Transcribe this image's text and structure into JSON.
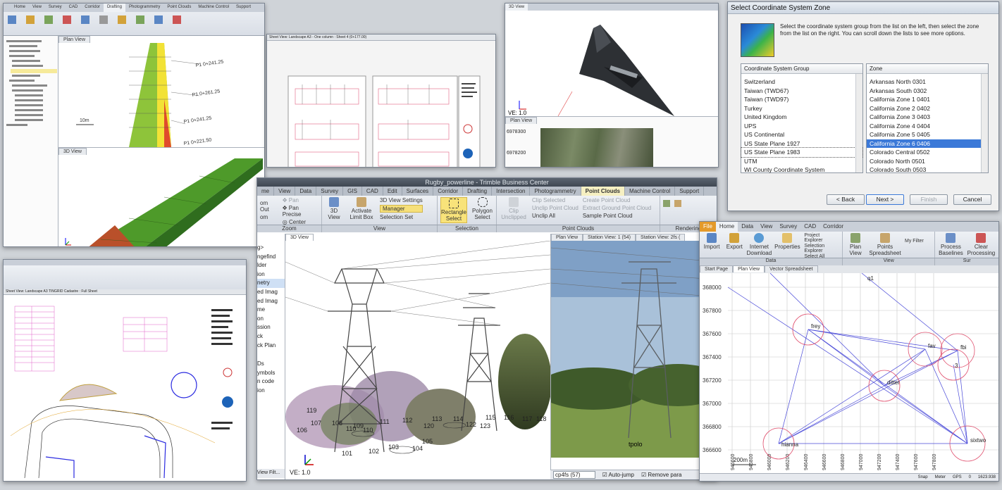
{
  "main": {
    "title": "Rugby_powerline - Trimble Business Center",
    "tabs": [
      "me",
      "View",
      "Data",
      "Survey",
      "GIS",
      "CAD",
      "Edit",
      "Surfaces",
      "Corridor",
      "Drafting",
      "Intersection",
      "Photogrammetry",
      "Point Clouds",
      "Machine Control",
      "Support"
    ],
    "active_tab": "Point Clouds",
    "ribbon": {
      "zoom_items": [
        "Pan",
        "Pan Precise",
        "Center"
      ],
      "zoom_items_left": [
        "om Out",
        "om"
      ],
      "view_3d": "3D View",
      "activate_limit": "Activate Limit Box",
      "view_settings": "3D View Settings",
      "manager": "Manager",
      "selection_set": "Selection Set",
      "rect_select": "Rectangle Select",
      "poly_select": "Polygon Select",
      "clip_unclipped": "Clip Unclipped",
      "clip_items": [
        "Clip Selected",
        "Unclip Point Cloud",
        "Unclip All"
      ],
      "pc_items": [
        "Create Point Cloud",
        "Extract Ground Point Cloud",
        "Sample Point Cloud"
      ],
      "group_labels": [
        "Zoom",
        "View",
        "Selection",
        "Point Clouds",
        "Rendering"
      ]
    },
    "left_panel_items": [
      "g>",
      "ngefind",
      "lder",
      "ion",
      "netry",
      "ed Imag",
      "ed Imag",
      "me",
      "on",
      "ssion",
      "ck",
      "ck Plan",
      "Ds",
      "ymbols",
      "n code",
      "ion"
    ],
    "left_panel_footer": "View Filt...",
    "view_tabs": [
      "3D View",
      "Plan View",
      "Station View: 1 (54)",
      "Station View: 2fs ("
    ],
    "ve_label": "VE: 1.0",
    "point_labels": [
      "101",
      "102",
      "103",
      "104",
      "105",
      "106",
      "107",
      "108",
      "109",
      "110",
      "110",
      "111",
      "112",
      "113",
      "114",
      "115",
      "116",
      "117",
      "118",
      "119",
      "120",
      "122",
      "123"
    ],
    "photo_label": "tpolo",
    "station_select": "cp4fs (57)",
    "auto_jump": "Auto-jump",
    "remove_para": "Remove para"
  },
  "coord_dialog": {
    "title": "Select Coordinate System Zone",
    "instructions": "Select the coordinate system group from the list on the left, then select the zone from the list on the right.  You can scroll down the lists to see more options.",
    "group_header": "Coordinate System Group",
    "groups": [
      "Switzerland",
      "Taiwan (TWD67)",
      "Taiwan (TWD97)",
      "Turkey",
      "United Kingdom",
      "UPS",
      "US Continental",
      "US State Plane 1927",
      "US State Plane 1983",
      "UTM",
      "WI County Coordinate System"
    ],
    "zone_header": "Zone",
    "zones": [
      "Arkansas North 0301",
      "Arkansas South 0302",
      "California Zone 1 0401",
      "California Zone 2 0402",
      "California Zone 3 0403",
      "California Zone 4 0404",
      "California Zone 5 0405",
      "California Zone 6 0406",
      "Colorado Central 0502",
      "Colorado North 0501",
      "Colorado South 0503"
    ],
    "selected_zone": "California Zone 6 0406",
    "back": "< Back",
    "next": "Next >",
    "finish": "Finish",
    "cancel": "Cancel"
  },
  "drone": {
    "tabs": [
      "3D View",
      "",
      "",
      ""
    ],
    "ve_label": "VE: 1.0",
    "plan_tab": "Plan View",
    "coord_labels": [
      "6978300",
      "6978200"
    ]
  },
  "network": {
    "tabs": [
      "File",
      "Home",
      "Data",
      "View",
      "Survey",
      "CAD",
      "Corridor"
    ],
    "active_tab": "Home",
    "buttons": [
      "Import",
      "Export",
      "Internet Download",
      "Properties"
    ],
    "list_items": [
      "Project Explorer",
      "Selection Explorer",
      "Select All"
    ],
    "view_buttons": [
      "Plan View",
      "Points Spreadsheet"
    ],
    "filter": "My Filter",
    "right_buttons": [
      "Process Baselines",
      "Clear Processing"
    ],
    "group_labels": [
      "Data",
      "View",
      "Sur"
    ],
    "view_tabs": [
      "Start Page",
      "Plan View",
      "Vector Spreadsheet"
    ],
    "y_ticks": [
      "368000",
      "367800",
      "367600",
      "367400",
      "367200",
      "367000",
      "366800",
      "366600"
    ],
    "x_ticks": [
      "945600",
      "945800",
      "946000",
      "946200",
      "946400",
      "946600",
      "946800",
      "947000",
      "947200",
      "947400",
      "947600",
      "947800"
    ],
    "stations": [
      "frey",
      "fav",
      "3",
      "fbi",
      "ditter",
      "hianna",
      "sixtwo",
      "q1"
    ],
    "scale": "200m",
    "status": [
      "Snap",
      "Meter",
      "GPS",
      "0",
      "1623.938"
    ]
  },
  "corridor": {
    "tabs": [
      "",
      "Home",
      "View",
      "Survey",
      "CAD",
      "Corridor",
      "Drafting",
      "Photogrammetry",
      "Point Clouds",
      "Machine Control",
      "Support"
    ],
    "labels": [
      "Plan View",
      "3D View"
    ],
    "stations": [
      "P1 0+241.25",
      "P1 0+261.25",
      "P1 0+241.25",
      "P1 0+221.50"
    ],
    "scale": "10m"
  },
  "sheets": {
    "tab": "Sheet View: Landscape A3 - One column : Sheet 4 (0+177.00)"
  },
  "plan": {
    "tab": "Sheet View: Landscape A3 TINGRID Cadastre : Full Sheet"
  }
}
